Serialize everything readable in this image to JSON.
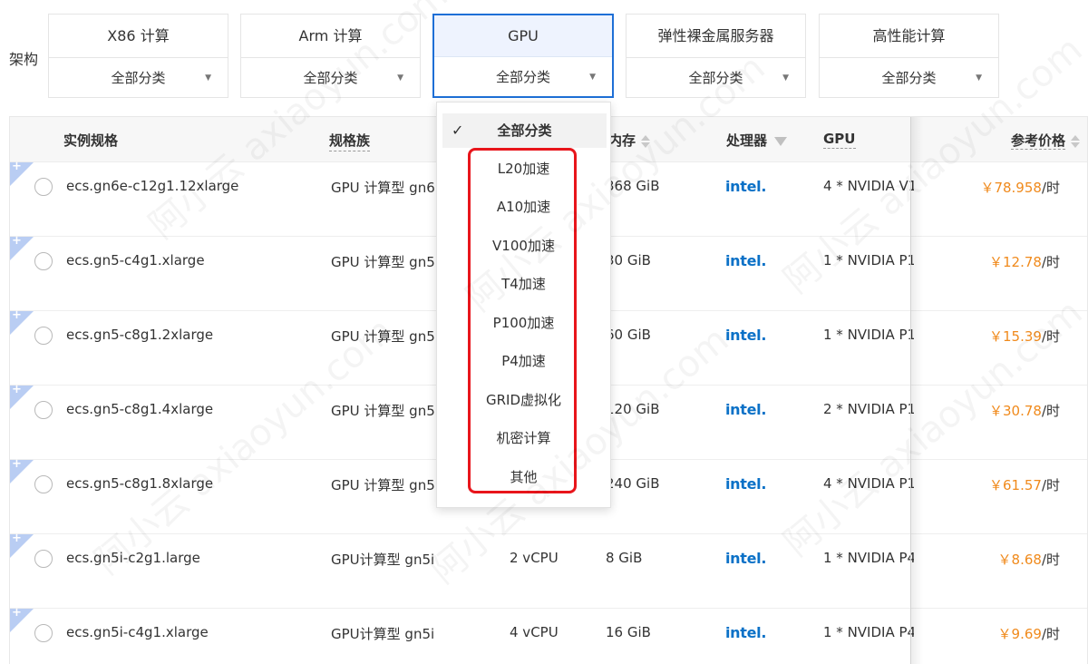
{
  "architecture": {
    "label": "架构",
    "cards": [
      {
        "title": "X86 计算",
        "select": "全部分类"
      },
      {
        "title": "Arm 计算",
        "select": "全部分类"
      },
      {
        "title": "GPU",
        "select": "全部分类"
      },
      {
        "title": "弹性裸金属服务器",
        "select": "全部分类"
      },
      {
        "title": "高性能计算",
        "select": "全部分类"
      }
    ]
  },
  "table": {
    "headers": {
      "spec": "实例规格",
      "family": "规格族",
      "memory": "内存",
      "processor": "处理器",
      "gpu": "GPU",
      "price": "参考价格"
    },
    "rows": [
      {
        "spec": "ecs.gn6e-c12g1.12xlarge",
        "family": "GPU 计算型 gn6",
        "vcpu": "",
        "memory": "368 GiB",
        "processor": "intel.",
        "gpu": "4 * NVIDIA V1",
        "price": "￥78.958",
        "unit": "/时"
      },
      {
        "spec": "ecs.gn5-c4g1.xlarge",
        "family": "GPU 计算型 gn5",
        "vcpu": "",
        "memory": "30 GiB",
        "processor": "intel.",
        "gpu": "1 * NVIDIA P1",
        "price": "￥12.78",
        "unit": "/时"
      },
      {
        "spec": "ecs.gn5-c8g1.2xlarge",
        "family": "GPU 计算型 gn5",
        "vcpu": "",
        "memory": "60 GiB",
        "processor": "intel.",
        "gpu": "1 * NVIDIA P1",
        "price": "￥15.39",
        "unit": "/时"
      },
      {
        "spec": "ecs.gn5-c8g1.4xlarge",
        "family": "GPU 计算型 gn5",
        "vcpu": "",
        "memory": "120 GiB",
        "processor": "intel.",
        "gpu": "2 * NVIDIA P1",
        "price": "￥30.78",
        "unit": "/时"
      },
      {
        "spec": "ecs.gn5-c8g1.8xlarge",
        "family": "GPU 计算型 gn5",
        "vcpu": "",
        "memory": "240 GiB",
        "processor": "intel.",
        "gpu": "4 * NVIDIA P1",
        "price": "￥61.57",
        "unit": "/时"
      },
      {
        "spec": "ecs.gn5i-c2g1.large",
        "family": "GPU计算型 gn5i",
        "vcpu": "2 vCPU",
        "memory": "8 GiB",
        "processor": "intel.",
        "gpu": "1 * NVIDIA P4",
        "price": "￥8.68",
        "unit": "/时"
      },
      {
        "spec": "ecs.gn5i-c4g1.xlarge",
        "family": "GPU计算型 gn5i",
        "vcpu": "4 vCPU",
        "memory": "16 GiB",
        "processor": "intel.",
        "gpu": "1 * NVIDIA P4",
        "price": "￥9.69",
        "unit": "/时"
      }
    ]
  },
  "dropdown": {
    "selected": "全部分类",
    "check": "✓",
    "options": [
      "L20加速",
      "A10加速",
      "V100加速",
      "T4加速",
      "P100加速",
      "P4加速",
      "GRID虚拟化",
      "机密计算",
      "其他"
    ]
  },
  "watermark": "阿小云 axiaoyun.com",
  "colors": {
    "accent": "#1e6fd6",
    "price": "#f08a1c",
    "intel": "#0b71c7",
    "highlight": "#e8151b",
    "corner": "#b9cdf3"
  }
}
